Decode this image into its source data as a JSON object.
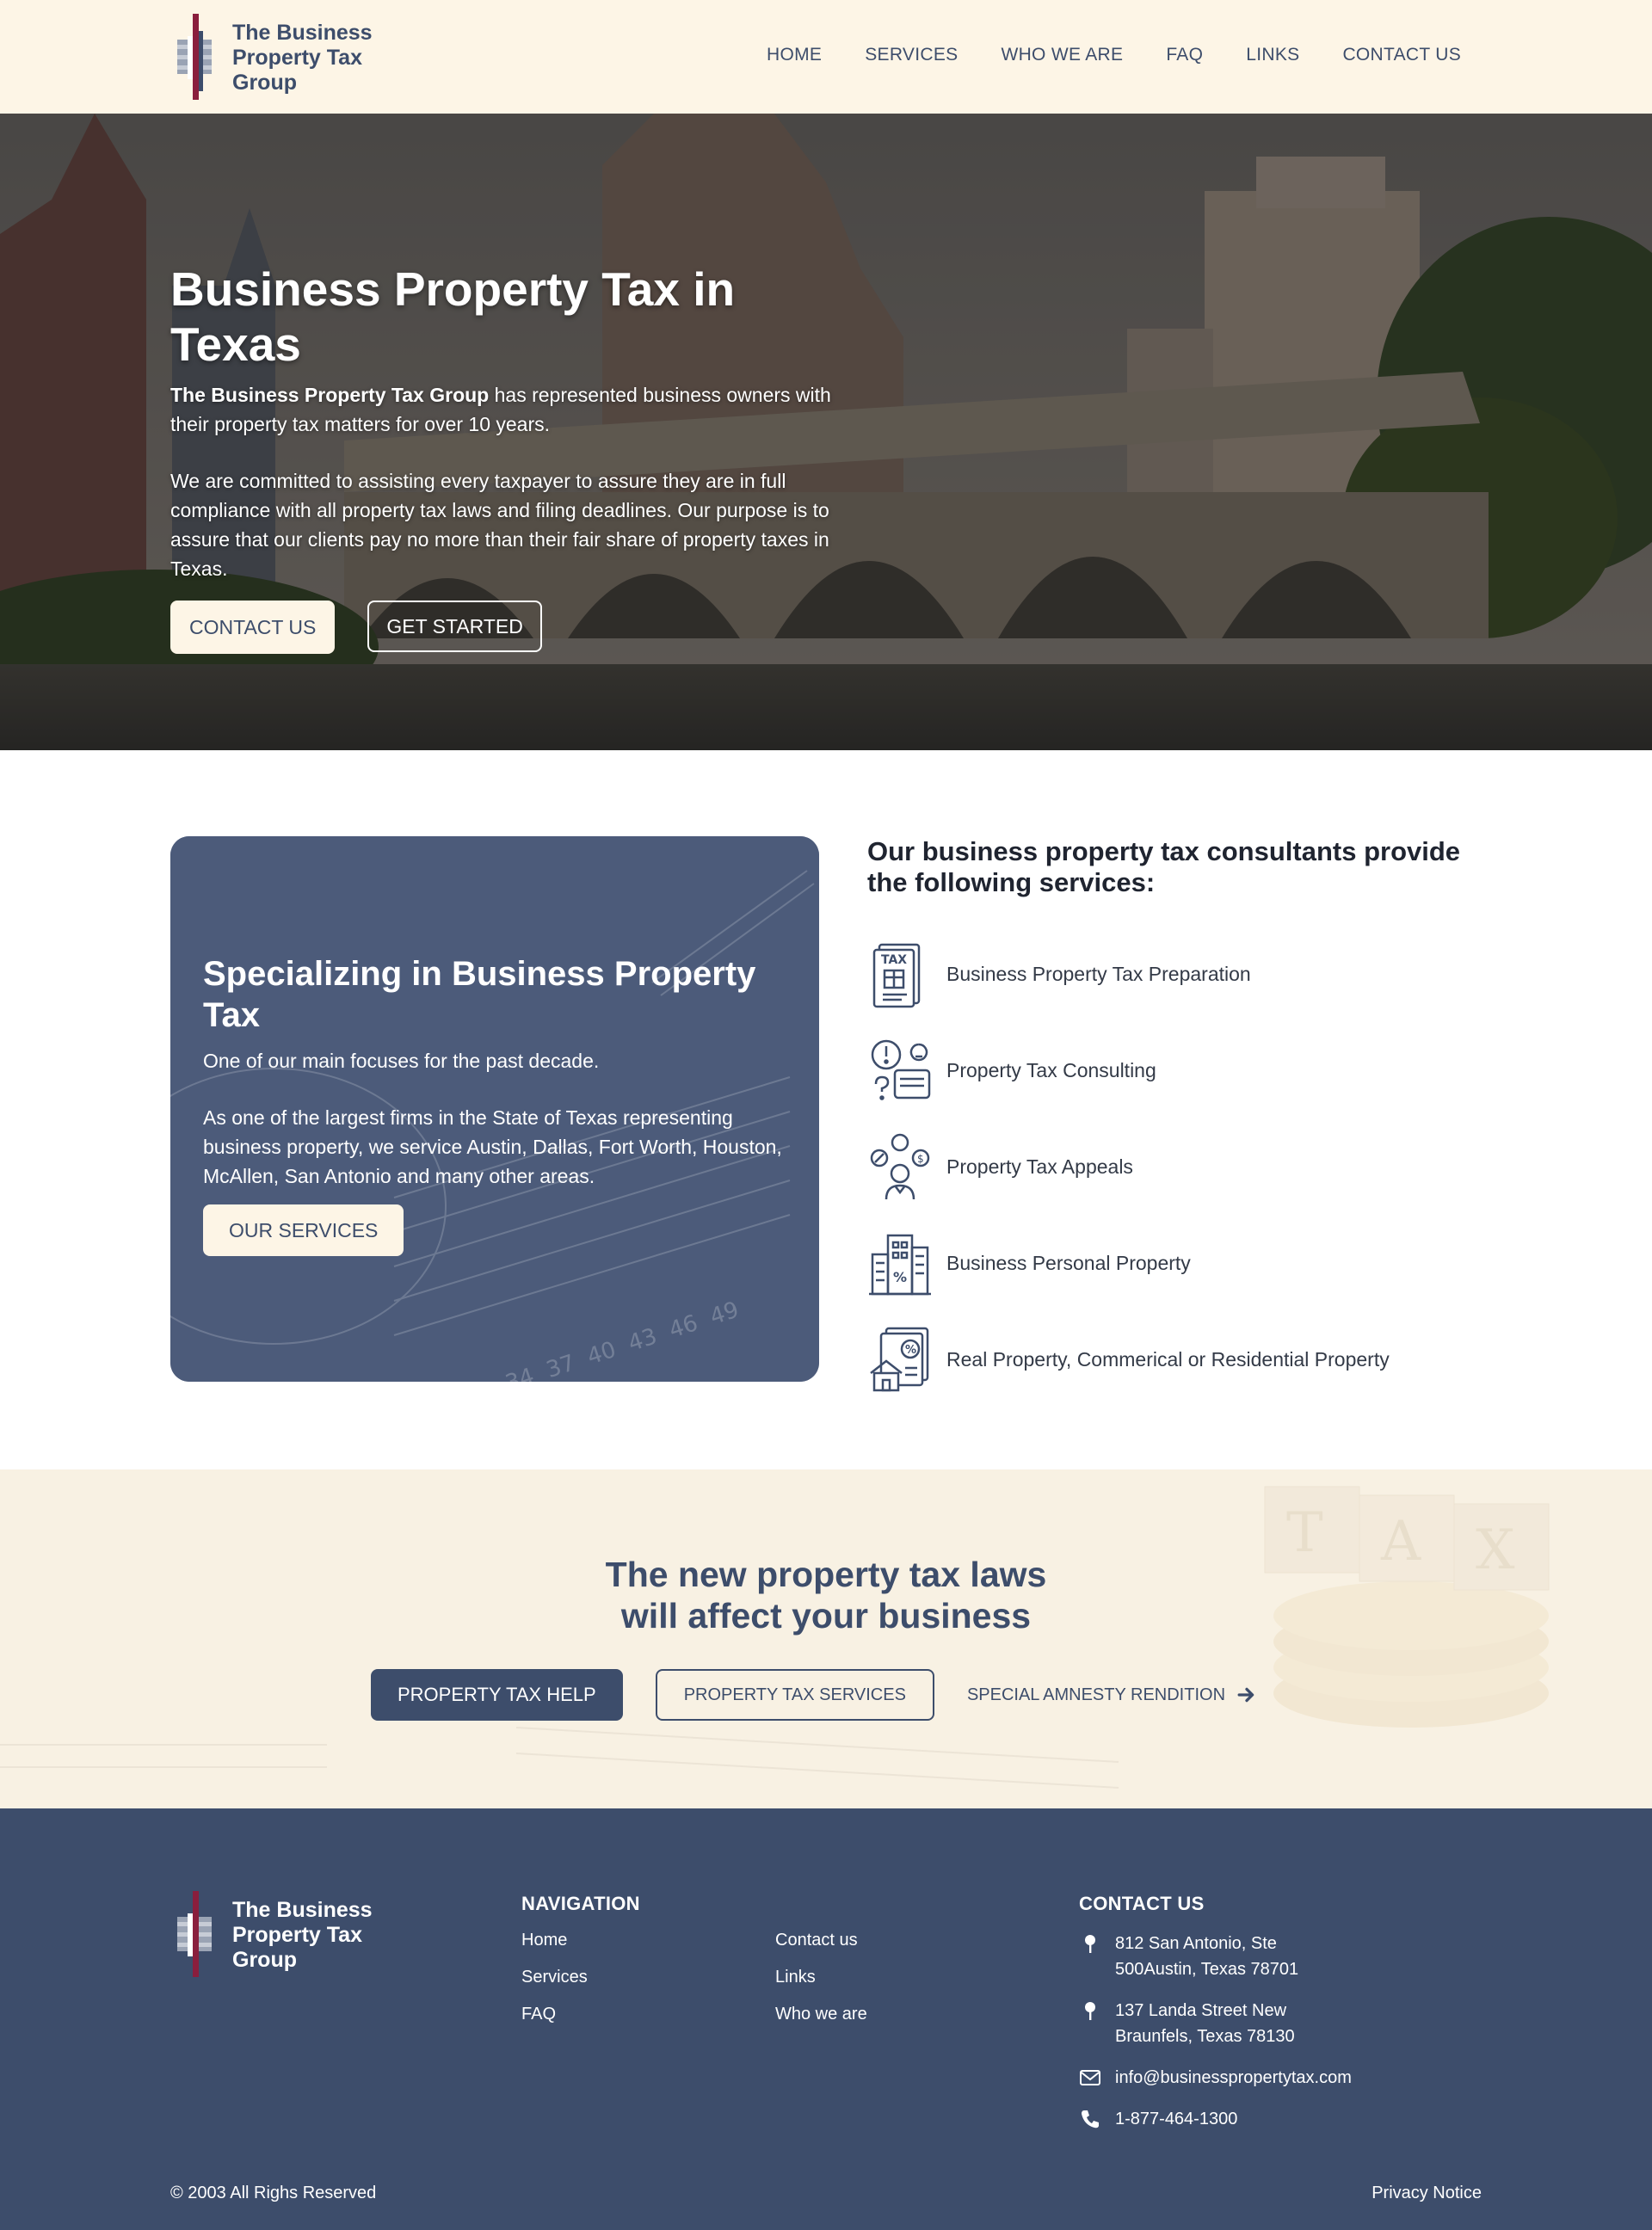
{
  "brand": {
    "name": "The Business Property Tax Group",
    "name_line1": "The Business",
    "name_line2": "Property Tax",
    "name_line3": "Group",
    "colors": {
      "navy": "#3d4d6b",
      "cream": "#fdf5e6",
      "maroon": "#8a1e3d"
    }
  },
  "nav": {
    "items": [
      {
        "label": "HOME"
      },
      {
        "label": "SERVICES"
      },
      {
        "label": "WHO WE ARE"
      },
      {
        "label": "FAQ"
      },
      {
        "label": "LINKS"
      },
      {
        "label": "CONTACT US"
      }
    ]
  },
  "hero": {
    "title": "Business Property Tax in Texas",
    "intro_bold": "The Business Property Tax Group",
    "intro_rest": " has represented business owners with their property tax matters for over 10 years.",
    "paragraph": "We are committed to assisting every taxpayer to assure they are in full compliance with all property tax laws and filing deadlines. Our purpose is to assure that our clients pay no more than their fair share of property taxes in Texas.",
    "button_contact": "CONTACT US",
    "button_started": "GET STARTED"
  },
  "specializing": {
    "title": "Specializing in Business Property Tax",
    "subtitle": "One of our main focuses for the past decade.",
    "paragraph": "As one of the largest firms in the State of Texas representing business property, we service Austin, Dallas, Fort Worth, Houston, McAllen, San Antonio and many other areas.",
    "button": "OUR SERVICES"
  },
  "services": {
    "heading": "Our business property tax consultants provide the following services:",
    "items": [
      {
        "label": "Business Property Tax Preparation",
        "icon": "tax-document-icon"
      },
      {
        "label": "Property Tax Consulting",
        "icon": "consulting-icon"
      },
      {
        "label": "Property Tax Appeals",
        "icon": "appeals-icon"
      },
      {
        "label": "Business Personal Property",
        "icon": "buildings-percent-icon"
      },
      {
        "label": "Real Property, Commerical or Residential Property",
        "icon": "house-tax-icon"
      }
    ]
  },
  "laws": {
    "title_line1": "The new property tax laws",
    "title_line2": "will affect your business",
    "button_help": "PROPERTY TAX HELP",
    "button_services": "PROPERTY TAX SERVICES",
    "link_amnesty": "SPECIAL AMNESTY RENDITION"
  },
  "footer": {
    "nav_heading": "NAVIGATION",
    "nav_links": [
      {
        "label": "Home"
      },
      {
        "label": "Contact us"
      },
      {
        "label": "Services"
      },
      {
        "label": "Links"
      },
      {
        "label": "FAQ"
      },
      {
        "label": "Who we are"
      }
    ],
    "contact_heading": "CONTACT US",
    "address1_line1": "812 San Antonio, Ste",
    "address1_line2": "500Austin, Texas 78701",
    "address2_line1": "137 Landa Street New",
    "address2_line2": "Braunfels, Texas 78130",
    "email": "info@businesspropertytax.com",
    "phone": "1-877-464-1300",
    "copyright": "© 2003 All Righs Reserved",
    "privacy": "Privacy Notice"
  }
}
